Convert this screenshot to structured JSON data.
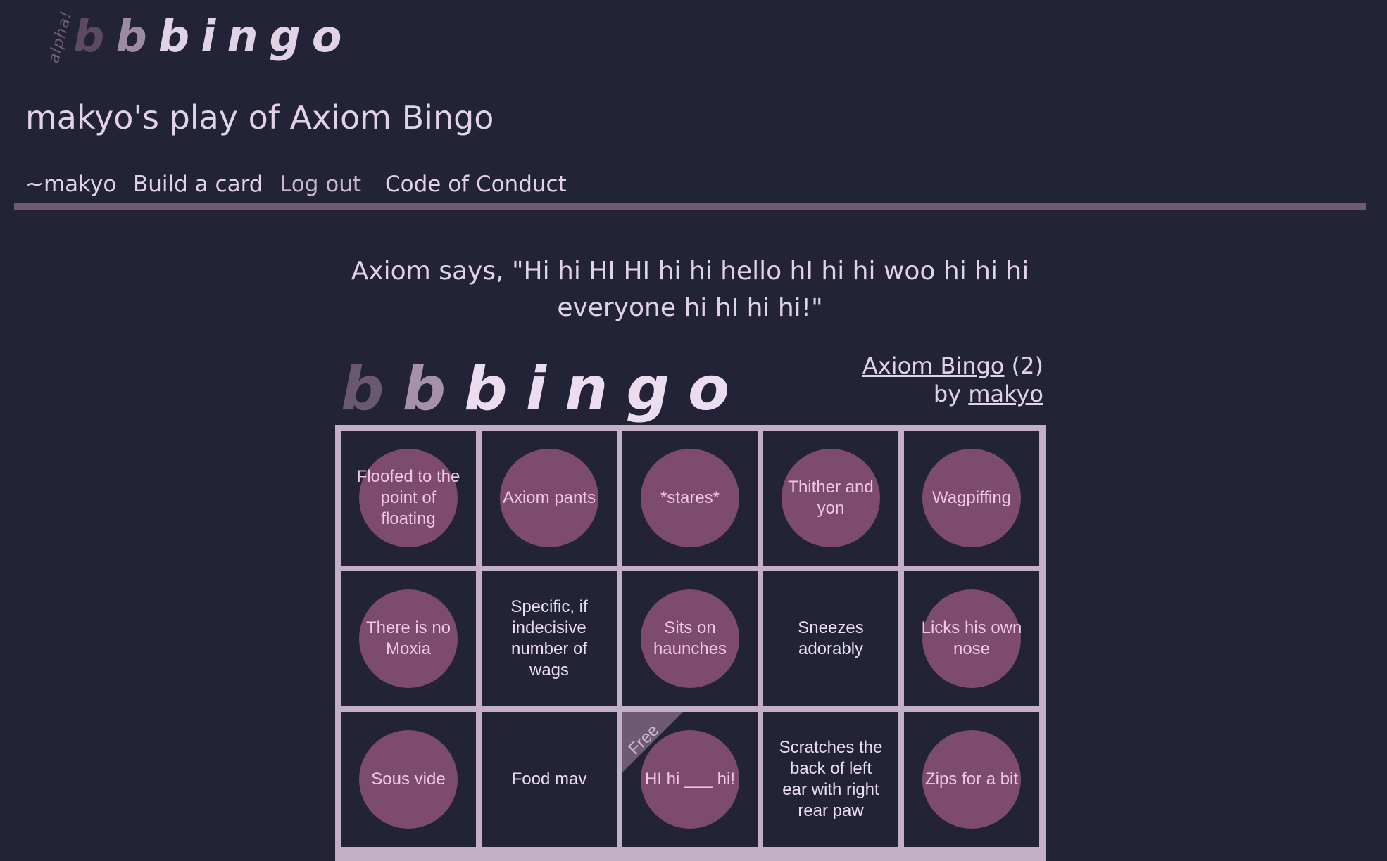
{
  "header": {
    "alpha_label": "alpha!",
    "logo_letters": [
      "b",
      "b",
      "bingo"
    ]
  },
  "page": {
    "title": "makyo's play of Axiom Bingo"
  },
  "nav": {
    "items": [
      {
        "label": "~makyo"
      },
      {
        "label": "Build a card"
      },
      {
        "label": "Log out"
      },
      {
        "label": "Code of Conduct"
      }
    ]
  },
  "quote": "Axiom says, \"Hi hi HI HI hi hi hello hI hi hi woo hi hi hi everyone hi hI hi hi!\"",
  "card": {
    "logo_letters": [
      "b",
      "b",
      "bingo"
    ],
    "card_name": "Axiom Bingo",
    "card_count": "(2)",
    "by_label": "by",
    "author": "makyo",
    "free_label": "Free",
    "cells": [
      {
        "text": "Floofed to the point of floating",
        "marked": true
      },
      {
        "text": "Axiom pants",
        "marked": true
      },
      {
        "text": "*stares*",
        "marked": true
      },
      {
        "text": "Thither and yon",
        "marked": true
      },
      {
        "text": "Wagpiffing",
        "marked": true
      },
      {
        "text": "There is no Moxia",
        "marked": true
      },
      {
        "text": "Specific, if indecisive number of wags",
        "marked": false
      },
      {
        "text": "Sits on haunches",
        "marked": true
      },
      {
        "text": "Sneezes adorably",
        "marked": false
      },
      {
        "text": "Licks his own nose",
        "marked": true
      },
      {
        "text": "Sous vide",
        "marked": true
      },
      {
        "text": "Food mav",
        "marked": false
      },
      {
        "text": "HI hi ___ hi!",
        "marked": true,
        "free": true
      },
      {
        "text": "Scratches the back of left ear with right rear paw",
        "marked": false
      },
      {
        "text": "Zips for a bit",
        "marked": true
      }
    ]
  },
  "colors": {
    "background": "#232337",
    "text": "#e2d2e6",
    "accent": "#7c4b6d",
    "board_border": "#c4b0c6",
    "nav_rule": "#6f5a73"
  }
}
